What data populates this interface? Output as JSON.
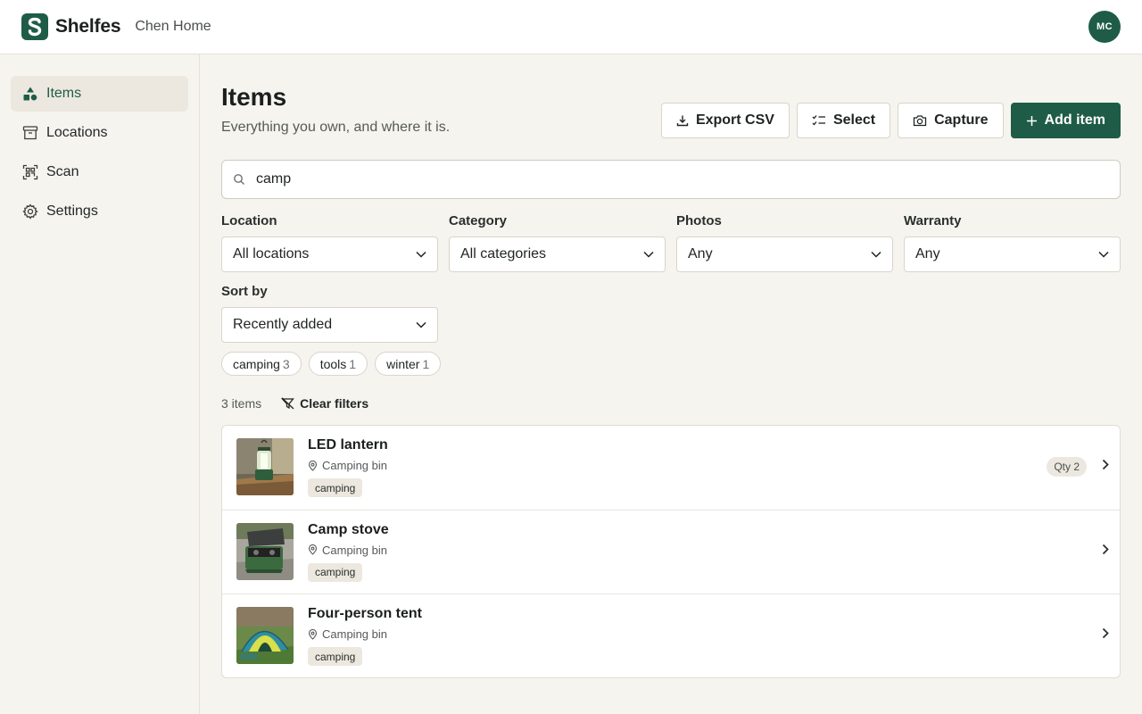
{
  "header": {
    "brand": "Shelfes",
    "workspace": "Chen Home",
    "avatar_initials": "MC",
    "accent_color": "#1f5c47"
  },
  "sidebar": {
    "items": [
      {
        "label": "Items",
        "icon": "shapes-icon",
        "active": true
      },
      {
        "label": "Locations",
        "icon": "archive-box-icon",
        "active": false
      },
      {
        "label": "Scan",
        "icon": "qr-scan-icon",
        "active": false
      },
      {
        "label": "Settings",
        "icon": "gear-icon",
        "active": false
      }
    ]
  },
  "page": {
    "title": "Items",
    "subtitle": "Everything you own, and where it is."
  },
  "actions": {
    "export": "Export CSV",
    "select": "Select",
    "capture": "Capture",
    "add": "Add item"
  },
  "search": {
    "value": "camp"
  },
  "filters": {
    "location": {
      "label": "Location",
      "value": "All locations"
    },
    "category": {
      "label": "Category",
      "value": "All categories"
    },
    "photos": {
      "label": "Photos",
      "value": "Any"
    },
    "warranty": {
      "label": "Warranty",
      "value": "Any"
    },
    "sort": {
      "label": "Sort by",
      "value": "Recently added"
    }
  },
  "tags": [
    {
      "name": "camping",
      "count": "3"
    },
    {
      "name": "tools",
      "count": "1"
    },
    {
      "name": "winter",
      "count": "1"
    }
  ],
  "results": {
    "count": "3 items",
    "clear_label": "Clear filters"
  },
  "items": [
    {
      "name": "LED lantern",
      "location": "Camping bin",
      "tag": "camping",
      "qty": "Qty 2"
    },
    {
      "name": "Camp stove",
      "location": "Camping bin",
      "tag": "camping"
    },
    {
      "name": "Four-person tent",
      "location": "Camping bin",
      "tag": "camping"
    }
  ]
}
